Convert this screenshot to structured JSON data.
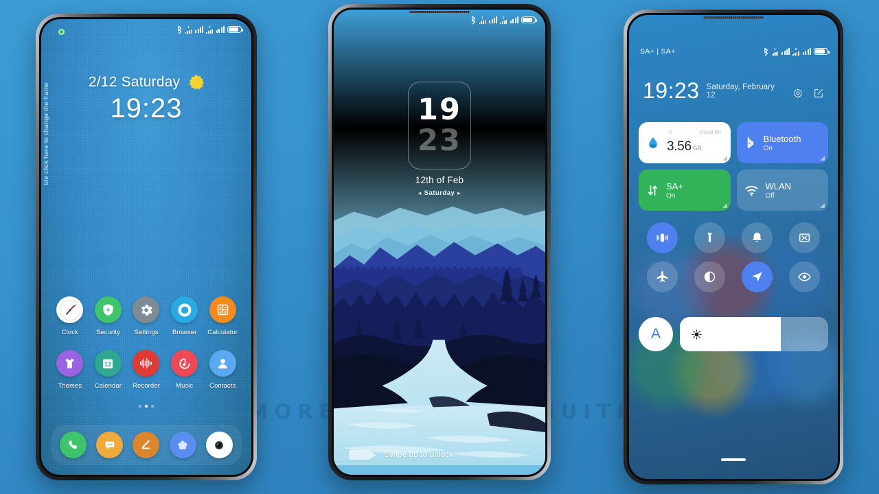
{
  "watermark": "VISIT  FOR  MORE  THEMES  -  MIUITHEMER.COM",
  "phone1": {
    "name": "home-screen",
    "statusbar": {
      "left": "",
      "icons": [
        "bluetooth-icon",
        "sim1-signal-icon",
        "signal-bars-icon",
        "sim2-signal-icon",
        "signal-bars-icon",
        "battery-icon"
      ]
    },
    "hint_text": "ble click here to change the frame",
    "date": "2/12 Saturday",
    "time": "19:23",
    "weather_icon": "sun-icon",
    "apps_row1": [
      {
        "label": "Clock",
        "icon": "clock-icon",
        "bg": "#ffffff"
      },
      {
        "label": "Security",
        "icon": "shield-icon",
        "bg": "#3ec46d"
      },
      {
        "label": "Settings",
        "icon": "gear-icon",
        "bg": "#7e8b95"
      },
      {
        "label": "Browser",
        "icon": "browser-icon",
        "bg": "#29aae3"
      },
      {
        "label": "Calculator",
        "icon": "calculator-icon",
        "bg": "#f28a1e"
      }
    ],
    "apps_row2": [
      {
        "label": "Themes",
        "icon": "tshirt-icon",
        "bg": "#9a63e0"
      },
      {
        "label": "Calendar",
        "icon": "calendar-icon",
        "bg": "#2fa88f",
        "day": "12"
      },
      {
        "label": "Recorder",
        "icon": "waveform-icon",
        "bg": "#e03a35"
      },
      {
        "label": "Music",
        "icon": "music-note-icon",
        "bg": "#ee4a55"
      },
      {
        "label": "Contacts",
        "icon": "person-icon",
        "bg": "#5aa9f0"
      }
    ],
    "dock": [
      {
        "label": "Phone",
        "icon": "phone-handset-icon",
        "bg": "#3ec46d"
      },
      {
        "label": "Messages",
        "icon": "chat-bubble-icon",
        "bg": "#efaa3c"
      },
      {
        "label": "Notes",
        "icon": "pencil-icon",
        "bg": "#d9862e"
      },
      {
        "label": "Gallery",
        "icon": "flower-icon",
        "bg": "#5a8df0"
      },
      {
        "label": "Camera",
        "icon": "camera-lens-icon",
        "bg": "#ffffff"
      }
    ]
  },
  "phone2": {
    "name": "lock-screen",
    "hours": "19",
    "minutes": "23",
    "date": "12th of Feb",
    "weekday": "Saturday",
    "unlock_text": "Swipe up to unlock",
    "wallpaper": "mountain-river-landscape"
  },
  "phone3": {
    "name": "control-center",
    "statusbar_left": "SA+ | SA+",
    "time": "19:23",
    "date": "Saturday, February 12",
    "header_icons": [
      "settings-gear-icon",
      "edit-icon"
    ],
    "big_tiles": [
      {
        "name": "mobile-data",
        "icon": "data-drop-icon",
        "sub_left": "h",
        "sub_right": "Used thi",
        "value": "3.56",
        "unit": "GB",
        "style": "light"
      },
      {
        "name": "bluetooth",
        "icon": "bluetooth-icon",
        "title": "Bluetooth",
        "state": "On",
        "style": "bt"
      },
      {
        "name": "mobile-network",
        "icon": "data-arrows-icon",
        "title": "SA+",
        "state": "On",
        "style": "sa"
      },
      {
        "name": "wlan",
        "icon": "wifi-icon",
        "title": "WLAN",
        "state": "Off",
        "style": "wlan"
      }
    ],
    "toggles": [
      {
        "name": "vibrate",
        "icon": "vibrate-icon",
        "on": true
      },
      {
        "name": "flashlight",
        "icon": "flashlight-icon",
        "on": false
      },
      {
        "name": "ringer",
        "icon": "bell-icon",
        "on": false
      },
      {
        "name": "screenshot",
        "icon": "screenshot-icon",
        "on": false
      },
      {
        "name": "airplane",
        "icon": "airplane-icon",
        "on": false
      },
      {
        "name": "dark-mode",
        "icon": "contrast-icon",
        "on": false
      },
      {
        "name": "location",
        "icon": "location-arrow-icon",
        "on": true
      },
      {
        "name": "reading-mode",
        "icon": "eye-icon",
        "on": false
      }
    ],
    "auto_brightness_label": "A",
    "brightness_percent": 68,
    "brightness_icon": "sun-small-icon"
  }
}
